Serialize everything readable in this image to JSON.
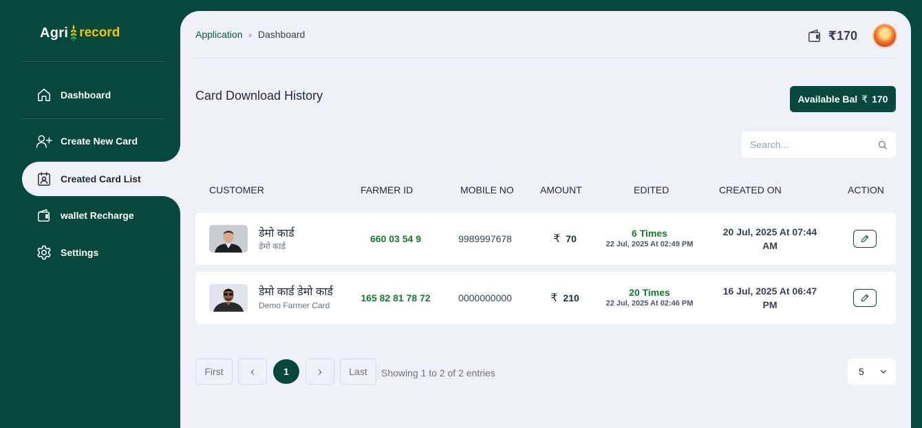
{
  "brand": {
    "part1": "Agri",
    "part2": "record"
  },
  "sidebar": {
    "items": [
      {
        "label": "Dashboard",
        "icon": "home-icon"
      },
      {
        "label": "Create New Card",
        "icon": "user-plus-icon"
      },
      {
        "label": "Created Card List",
        "icon": "id-card-icon",
        "active": true
      },
      {
        "label": "wallet Recharge",
        "icon": "wallet-icon"
      },
      {
        "label": "Settings",
        "icon": "gear-icon"
      }
    ]
  },
  "header": {
    "breadcrumb": [
      "Application",
      "Dashboard"
    ],
    "wallet_amount": "₹170"
  },
  "page": {
    "title": "Card Download History",
    "balance_label": "Available Bal",
    "balance_currency": "₹",
    "balance_value": "170"
  },
  "search": {
    "placeholder": "Search..."
  },
  "table": {
    "columns": [
      "CUSTOMER",
      "FARMER ID",
      "MOBILE NO",
      "AMOUNT",
      "EDITED",
      "CREATED ON",
      "ACTION"
    ],
    "rows": [
      {
        "name": "डेमो कार्ड",
        "sub": "डेमो कार्ड",
        "farmer_id": "660 03 54 9",
        "mobile": "9989997678",
        "currency": "₹",
        "amount": "70",
        "edited_count": "6 Times",
        "edited_date": "22 Jul, 2025 At 02:49 PM",
        "created_on": "20 Jul, 2025 At 07:44 AM"
      },
      {
        "name": "डेमो कार्ड डेमो कार्ड",
        "sub": "Demo Farmer Card",
        "farmer_id": "165 82 81 78 72",
        "mobile": "0000000000",
        "currency": "₹",
        "amount": "210",
        "edited_count": "20 Times",
        "edited_date": "22 Jul, 2025 At 02:46 PM",
        "created_on": "16 Jul, 2025 At 06:47 PM"
      }
    ]
  },
  "pagination": {
    "first": "First",
    "prev": "‹",
    "current": "1",
    "next": "›",
    "last": "Last",
    "info": "Showing 1 to 2 of 2 entries",
    "page_size": "5"
  },
  "colors": {
    "brand_green": "#06493a",
    "accent_yellow": "#f4c10c",
    "id_green": "#137a2f",
    "panel_bg": "#eef2f6"
  }
}
